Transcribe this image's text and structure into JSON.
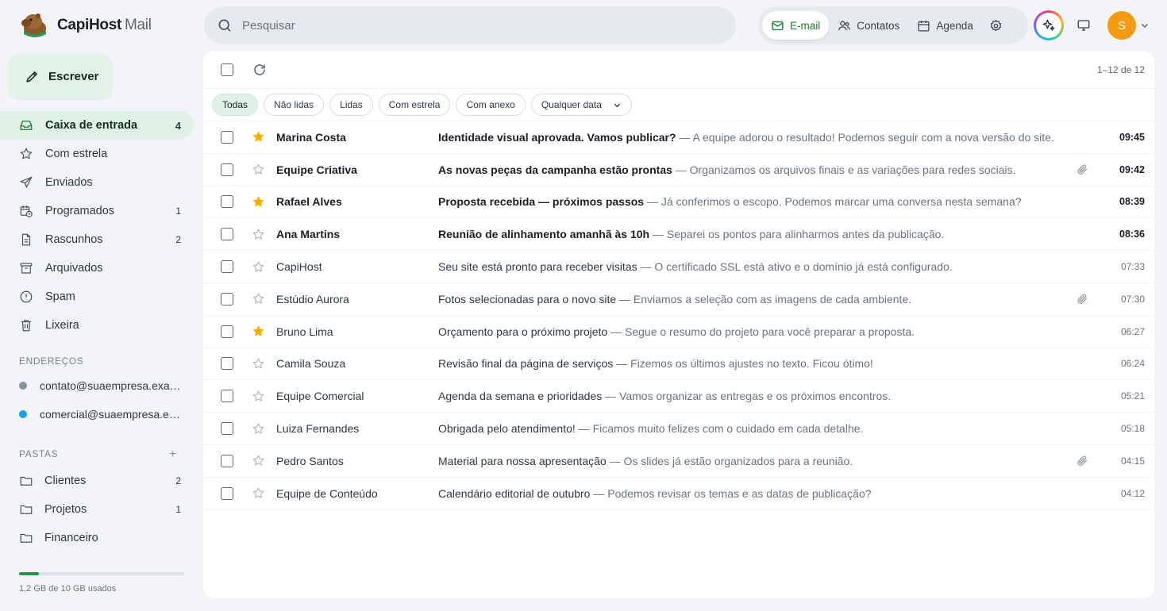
{
  "brand": {
    "name": "CapiHost",
    "sub": "Mail"
  },
  "search": {
    "placeholder": "Pesquisar"
  },
  "apps": {
    "email": "E-mail",
    "contacts": "Contatos",
    "calendar": "Agenda"
  },
  "user": {
    "initial": "S",
    "avatar_color": "#f59b12"
  },
  "colors": {
    "accent": "#1f9a45",
    "selected_bg": "#e2f1e5",
    "star": "#f5b100"
  },
  "compose_label": "Escrever",
  "nav": [
    {
      "label": "Caixa de entrada",
      "count": "4",
      "icon": "inbox-icon"
    },
    {
      "label": "Com estrela",
      "count": "",
      "icon": "star-icon"
    },
    {
      "label": "Enviados",
      "count": "",
      "icon": "send-icon"
    },
    {
      "label": "Programados",
      "count": "1",
      "icon": "scheduled-icon"
    },
    {
      "label": "Rascunhos",
      "count": "2",
      "icon": "draft-icon"
    },
    {
      "label": "Arquivados",
      "count": "",
      "icon": "archive-icon"
    },
    {
      "label": "Spam",
      "count": "",
      "icon": "spam-icon"
    },
    {
      "label": "Lixeira",
      "count": "",
      "icon": "trash-icon"
    }
  ],
  "addresses": {
    "heading": "ENDEREÇOS",
    "items": [
      {
        "email": "contato@suaempresa.exa…",
        "color": "#8a939d"
      },
      {
        "email": "comercial@suaempresa.e…",
        "color": "#1ea0e6"
      }
    ]
  },
  "folders": {
    "heading": "PASTAS",
    "add": "+",
    "items": [
      {
        "label": "Clientes",
        "count": "2"
      },
      {
        "label": "Projetos",
        "count": "1"
      },
      {
        "label": "Financeiro",
        "count": ""
      }
    ]
  },
  "storage": {
    "text": "1,2 GB de 10 GB usados",
    "used_fraction": 0.12
  },
  "pager": "1–12 de 12",
  "filters": {
    "all": "Todas",
    "unread": "Não lidas",
    "read": "Lidas",
    "starred": "Com estrela",
    "attachment": "Com anexo",
    "date": "Qualquer data"
  },
  "emails": [
    {
      "sender": "Marina Costa",
      "subject": "Identidade visual aprovada. Vamos publicar?",
      "snippet": " — A equipe adorou o resultado! Podemos seguir com a nova versão do site.",
      "time": "09:45",
      "unread": true,
      "starred": true,
      "attachment": false
    },
    {
      "sender": "Equipe Criativa",
      "subject": "As novas peças da campanha estão prontas",
      "snippet": " — Organizamos os arquivos finais e as variações para redes sociais.",
      "time": "09:42",
      "unread": true,
      "starred": false,
      "attachment": true
    },
    {
      "sender": "Rafael Alves",
      "subject": "Proposta recebida — próximos passos",
      "snippet": " — Já conferimos o escopo. Podemos marcar uma conversa nesta semana?",
      "time": "08:39",
      "unread": true,
      "starred": true,
      "attachment": false
    },
    {
      "sender": "Ana Martins",
      "subject": "Reunião de alinhamento amanhã às 10h",
      "snippet": " — Separei os pontos para alinharmos antes da publicação.",
      "time": "08:36",
      "unread": true,
      "starred": false,
      "attachment": false
    },
    {
      "sender": "CapiHost",
      "subject": "Seu site está pronto para receber visitas",
      "snippet": " — O certificado SSL está ativo e o domínio já está configurado.",
      "time": "07:33",
      "unread": false,
      "starred": false,
      "attachment": false
    },
    {
      "sender": "Estúdio Aurora",
      "subject": "Fotos selecionadas para o novo site",
      "snippet": " — Enviamos a seleção com as imagens de cada ambiente.",
      "time": "07:30",
      "unread": false,
      "starred": false,
      "attachment": true
    },
    {
      "sender": "Bruno Lima",
      "subject": "Orçamento para o próximo projeto",
      "snippet": " — Segue o resumo do projeto para você preparar a proposta.",
      "time": "06:27",
      "unread": false,
      "starred": true,
      "attachment": false
    },
    {
      "sender": "Camila Souza",
      "subject": "Revisão final da página de serviços",
      "snippet": " — Fizemos os últimos ajustes no texto. Ficou ótimo!",
      "time": "06:24",
      "unread": false,
      "starred": false,
      "attachment": false
    },
    {
      "sender": "Equipe Comercial",
      "subject": "Agenda da semana e prioridades",
      "snippet": " — Vamos organizar as entregas e os próximos encontros.",
      "time": "05:21",
      "unread": false,
      "starred": false,
      "attachment": false
    },
    {
      "sender": "Luiza Fernandes",
      "subject": "Obrigada pelo atendimento!",
      "snippet": " — Ficamos muito felizes com o cuidado em cada detalhe.",
      "time": "05:18",
      "unread": false,
      "starred": false,
      "attachment": false
    },
    {
      "sender": "Pedro Santos",
      "subject": "Material para nossa apresentação",
      "snippet": " — Os slides já estão organizados para a reunião.",
      "time": "04:15",
      "unread": false,
      "starred": false,
      "attachment": true
    },
    {
      "sender": "Equipe de Conteúdo",
      "subject": "Calendário editorial de outubro",
      "snippet": " — Podemos revisar os temas e as datas de publicação?",
      "time": "04:12",
      "unread": false,
      "starred": false,
      "attachment": false
    }
  ]
}
